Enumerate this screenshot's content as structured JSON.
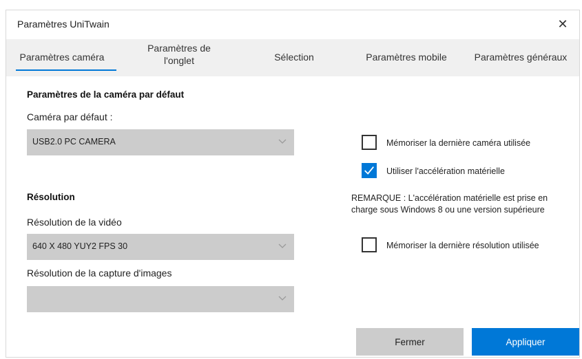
{
  "window": {
    "title": "Paramètres UniTwain"
  },
  "tabs": [
    {
      "label": "Paramètres caméra"
    },
    {
      "label_line1": "Paramètres de",
      "label_line2": "l'onglet"
    },
    {
      "label": "Sélection"
    },
    {
      "label": "Paramètres mobile"
    },
    {
      "label": "Paramètres généraux"
    }
  ],
  "camera": {
    "section_title": "Paramètres de la caméra par défaut",
    "default_label": "Caméra par défaut :",
    "default_value": "USB2.0 PC CAMERA"
  },
  "resolution": {
    "section_title": "Résolution",
    "video_label": "Résolution de la vidéo",
    "video_value": "640 X 480 YUY2 FPS 30",
    "capture_label": "Résolution de la capture d'images",
    "capture_value": ""
  },
  "options": {
    "remember_camera": {
      "label": "Mémoriser la dernière caméra utilisée",
      "checked": false
    },
    "hw_accel": {
      "label": "Utiliser l'accélération matérielle",
      "checked": true
    },
    "note_line1": "REMARQUE : L'accélération matérielle est prise en",
    "note_line2": "charge sous Windows 8 ou une version supérieure",
    "remember_resolution": {
      "label": "Mémoriser la dernière résolution utilisée",
      "checked": false
    }
  },
  "buttons": {
    "close": "Fermer",
    "apply": "Appliquer"
  },
  "colors": {
    "accent": "#0078d7",
    "control_gray": "#cccccc",
    "tab_bg": "#f0f0f0"
  }
}
